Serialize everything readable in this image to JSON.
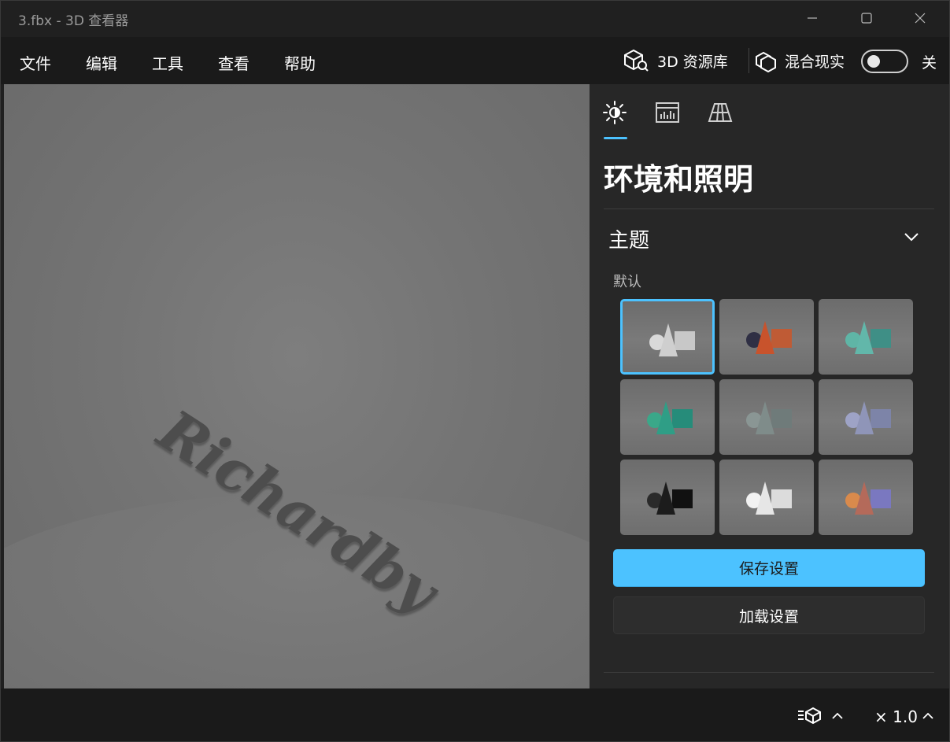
{
  "window": {
    "title": "3.fbx - 3D 查看器"
  },
  "menu": {
    "items": [
      {
        "label": "文件"
      },
      {
        "label": "编辑"
      },
      {
        "label": "工具"
      },
      {
        "label": "查看"
      },
      {
        "label": "帮助"
      }
    ],
    "library_label": "3D 资源库",
    "mixed_reality_label": "混合现实",
    "toggle_state": "关",
    "toggle_on": false
  },
  "viewport": {
    "model_text": "Richardby"
  },
  "panel": {
    "tabs": [
      {
        "icon": "sun-icon",
        "active": true
      },
      {
        "icon": "stats-icon",
        "active": false
      },
      {
        "icon": "grid-icon",
        "active": false
      }
    ],
    "title": "环境和照明",
    "section_title": "主题",
    "group_label": "默认",
    "themes": [
      {
        "selected": true,
        "colors": [
          "#d9d9d9",
          "#cfcfcf",
          "#c8c8c8"
        ]
      },
      {
        "selected": false,
        "colors": [
          "#2f2f44",
          "#c8532c",
          "#bf5b35"
        ]
      },
      {
        "selected": false,
        "colors": [
          "#5fb5a6",
          "#62b7aa",
          "#3f8f86"
        ]
      },
      {
        "selected": false,
        "colors": [
          "#3aa889",
          "#2f9e86",
          "#268c7a"
        ]
      },
      {
        "selected": false,
        "colors": [
          "#8a9694",
          "#7f8c8a",
          "#6f7b7a"
        ]
      },
      {
        "selected": false,
        "colors": [
          "#9ea3c6",
          "#8f95b8",
          "#7d84a8"
        ]
      },
      {
        "selected": false,
        "colors": [
          "#2a2a2a",
          "#1c1c1c",
          "#111111"
        ]
      },
      {
        "selected": false,
        "colors": [
          "#f2f2f2",
          "#e6e6e6",
          "#dcdcdc"
        ]
      },
      {
        "selected": false,
        "colors": [
          "#d98a4c",
          "#b46a5a",
          "#7a78c0"
        ]
      }
    ],
    "save_label": "保存设置",
    "load_label": "加载设置"
  },
  "statusbar": {
    "zoom_text": "× 1.0"
  },
  "colors": {
    "accent": "#4cc2ff",
    "background": "#202020"
  }
}
